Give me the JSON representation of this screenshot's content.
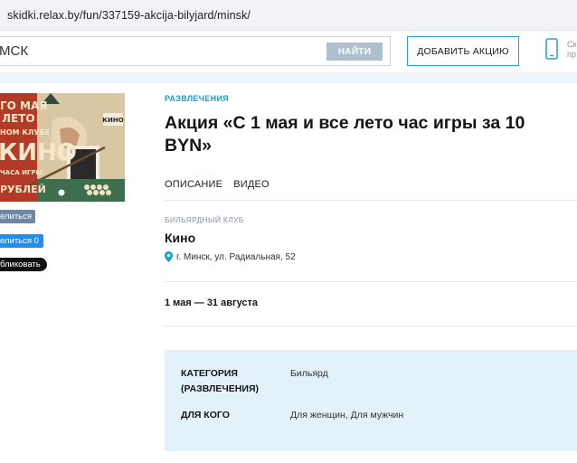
{
  "browser": {
    "url": "skidki.relax.by/fun/337159-akcija-bilyjard/minsk/"
  },
  "header": {
    "search_value": "МСК",
    "search_button": "НАЙТИ",
    "add_button": "ДОБАВИТЬ АКЦИЮ",
    "side_text": "Ск пр"
  },
  "poster": {
    "line1": "ГО МАЯ",
    "line2": "ЛЕТО",
    "line3": "НОМ КЛУБЕ",
    "line4": "КИНО",
    "line5": "ЧАСА ИГРЫ",
    "line6": "РУБЛЕЙ",
    "small": "КИНО"
  },
  "social": {
    "share": "елиться",
    "like": "елиться",
    "like_count": "0",
    "publish": "бликовать"
  },
  "promo": {
    "category": "РАЗВЛЕЧЕНИЯ",
    "title": "Акция «С 1 мая и все лето час игры за 10 BYN»",
    "tabs": [
      "ОПИСАНИЕ",
      "ВИДЕО"
    ],
    "venue_type": "БИЛЬЯРДНЫЙ КЛУБ",
    "venue_name": "Кино",
    "address": "г. Минск, ул. Радиальная, 52",
    "dates": "1 мая — 31 августа"
  },
  "info": [
    {
      "label": "КАТЕГОРИЯ (РАЗВЛЕЧЕНИЯ)",
      "value": "Бильярд"
    },
    {
      "label": "ДЛЯ КОГО",
      "value": "Для женщин, Для мужчин"
    }
  ],
  "colors": {
    "accent": "#1a9cc9",
    "info_bg": "#e3f1f8",
    "border_accent": "#29a4d6"
  }
}
